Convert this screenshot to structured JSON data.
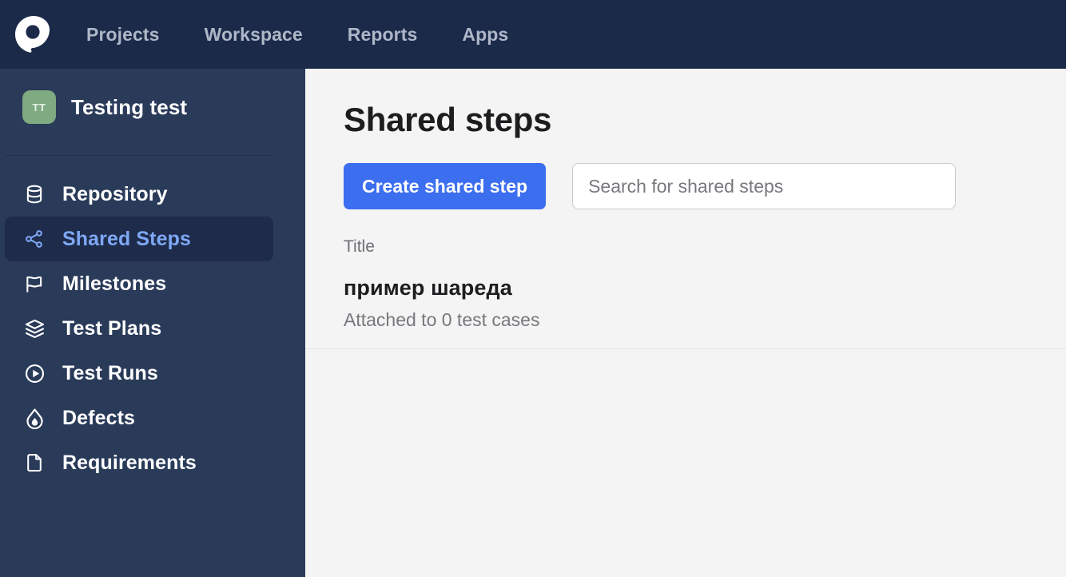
{
  "topbar": {
    "logo": "aqua-logo-icon",
    "nav": [
      {
        "label": "Projects"
      },
      {
        "label": "Workspace"
      },
      {
        "label": "Reports"
      },
      {
        "label": "Apps"
      }
    ]
  },
  "sidebar": {
    "project": {
      "avatar_initials": "TT",
      "avatar_color": "#7faa82",
      "name": "Testing test"
    },
    "items": [
      {
        "label": "Repository",
        "icon": "database-icon",
        "active": false
      },
      {
        "label": "Shared Steps",
        "icon": "share-nodes-icon",
        "active": true
      },
      {
        "label": "Milestones",
        "icon": "flag-icon",
        "active": false
      },
      {
        "label": "Test Plans",
        "icon": "layers-icon",
        "active": false
      },
      {
        "label": "Test Runs",
        "icon": "play-circle-icon",
        "active": false
      },
      {
        "label": "Defects",
        "icon": "flame-icon",
        "active": false
      },
      {
        "label": "Requirements",
        "icon": "file-icon",
        "active": false
      }
    ],
    "active_color": "#7fa8f5"
  },
  "main": {
    "page_title": "Shared steps",
    "create_button": "Create shared step",
    "search": {
      "placeholder": "Search for shared steps",
      "value": ""
    },
    "column_header": "Title",
    "accent_color": "#3c6ef0",
    "rows": [
      {
        "title": "пример шареда",
        "subtitle": "Attached to 0 test cases"
      }
    ]
  }
}
